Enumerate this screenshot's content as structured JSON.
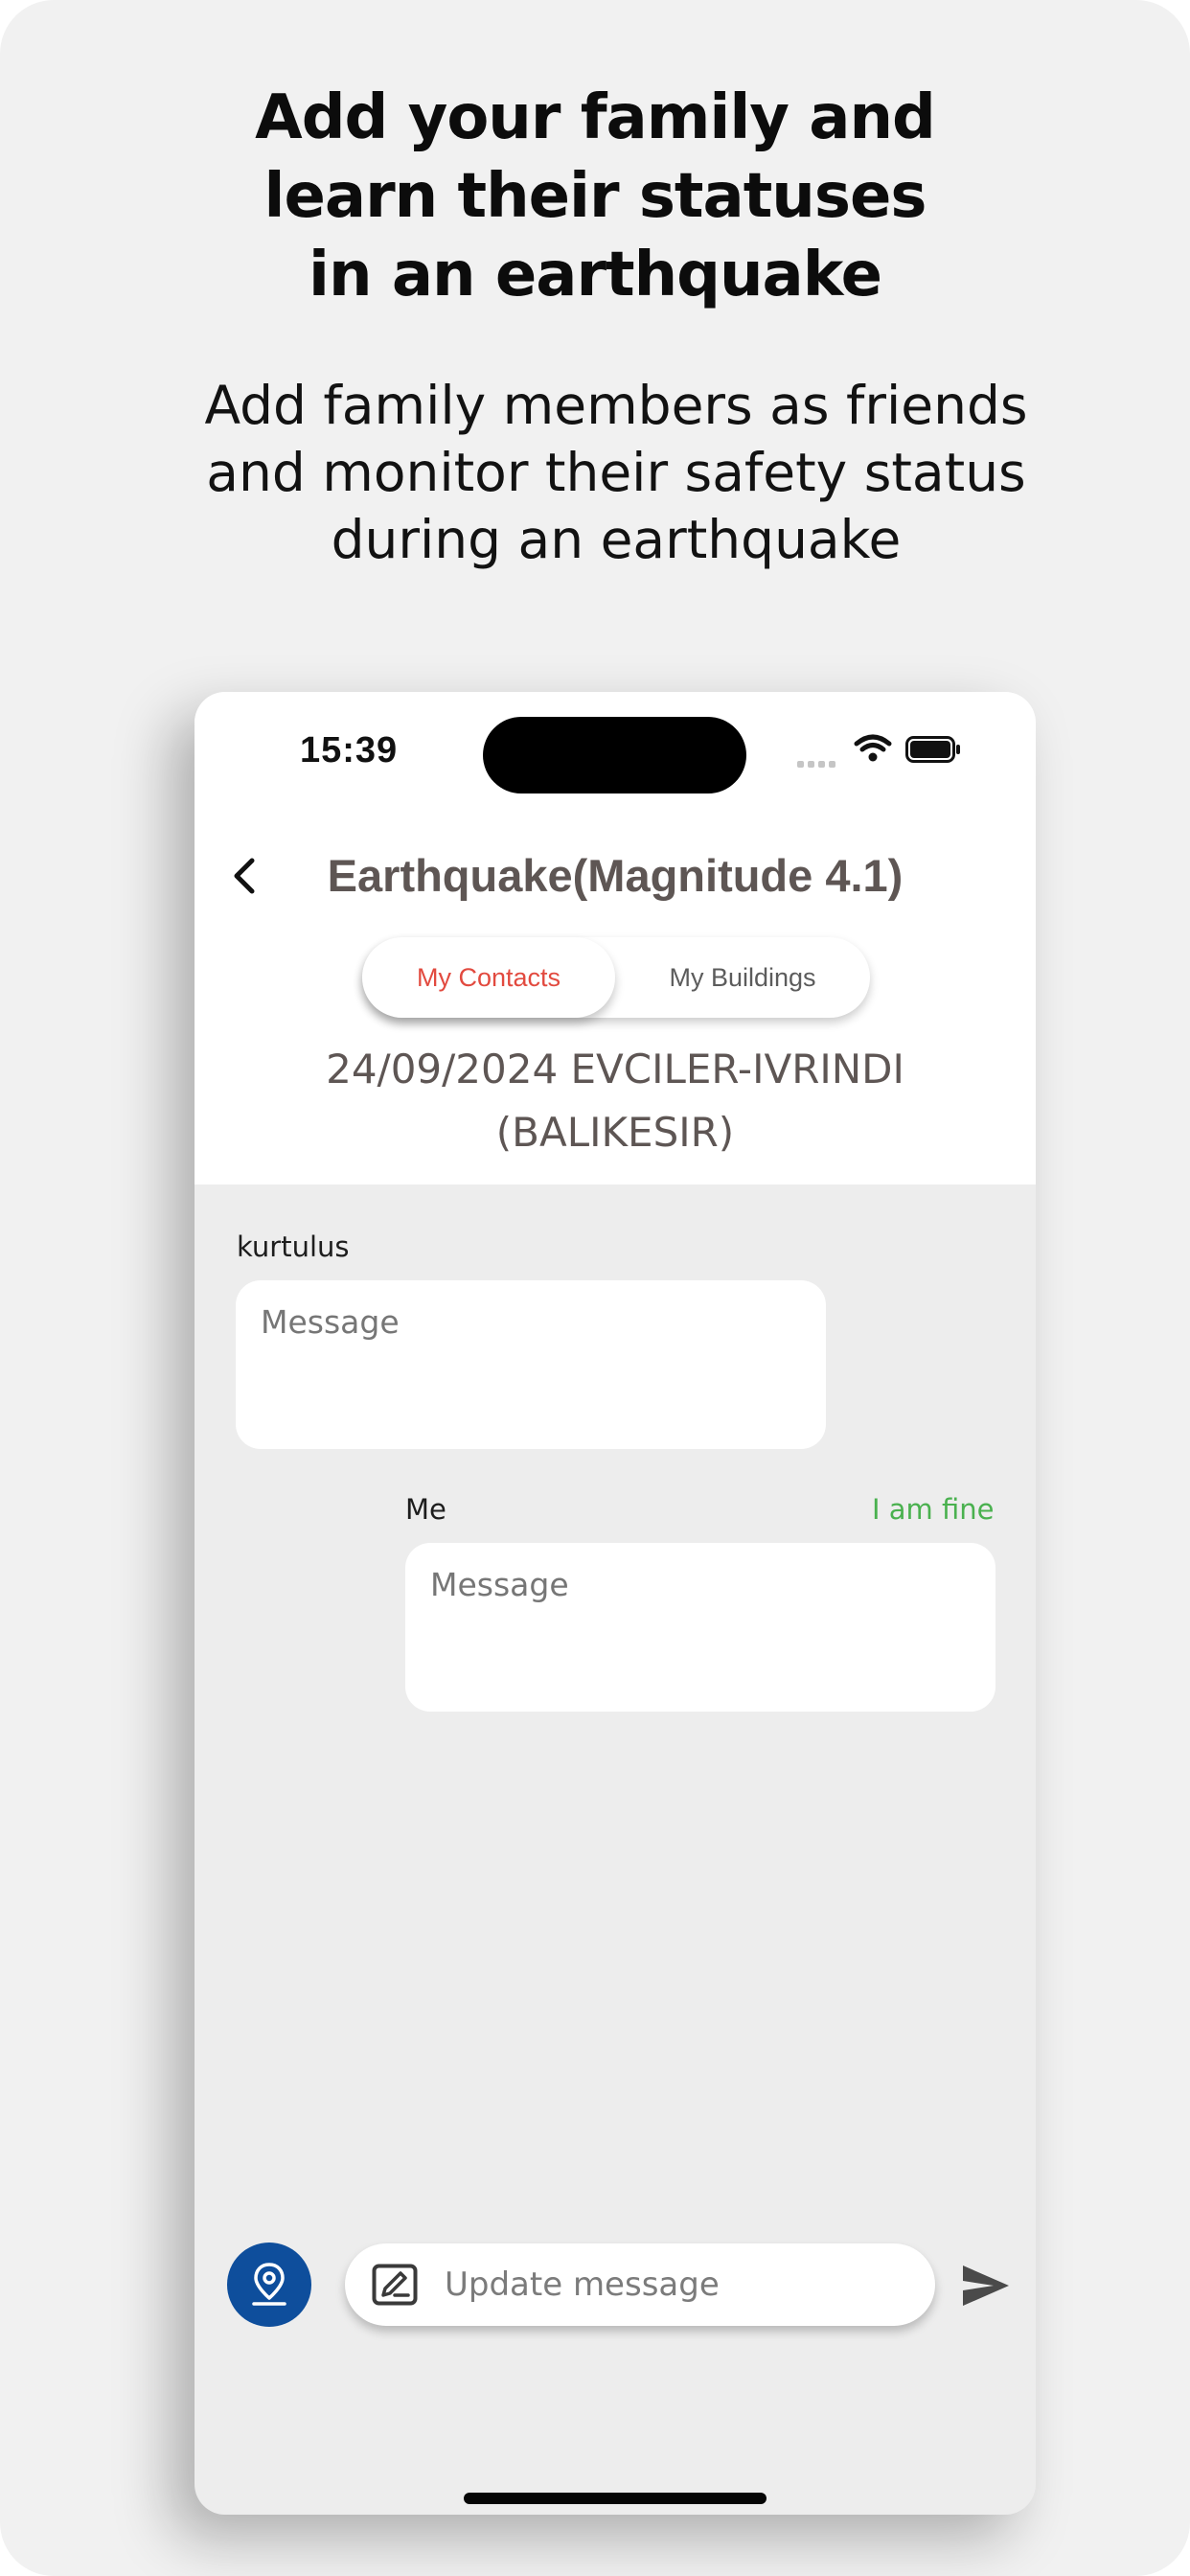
{
  "promo": {
    "headline_lines": [
      "Add your family and",
      "learn their statuses",
      "in an earthquake"
    ],
    "subline_lines": [
      "Add family members as friends",
      "and monitor their safety status",
      "during an earthquake"
    ]
  },
  "status_bar": {
    "time": "15:39",
    "icons": [
      "signal-icon",
      "wifi-icon",
      "battery-icon"
    ]
  },
  "screen": {
    "back_icon": "chevron-left-icon",
    "title": "Earthquake(Magnitude 4.1)"
  },
  "tabs": [
    {
      "label": "My Contacts",
      "active": true
    },
    {
      "label": "My Buildings",
      "active": false
    }
  ],
  "event": {
    "date_place_line1": "24/09/2024 EVCILER-IVRINDI",
    "date_place_line2": "(BALIKESIR)"
  },
  "messages": [
    {
      "sender": "kurtulus",
      "text": "Message",
      "status": ""
    },
    {
      "sender": "Me",
      "text": "Message",
      "status": "I am fine"
    }
  ],
  "composer": {
    "location_icon": "location-pin-icon",
    "edit_icon": "edit-message-icon",
    "placeholder": "Update message",
    "send_icon": "send-icon"
  },
  "colors": {
    "accent_red": "#e24a3f",
    "status_green": "#4ab14f",
    "location_blue": "#0e4e9c",
    "title_gray": "#5e5654"
  }
}
